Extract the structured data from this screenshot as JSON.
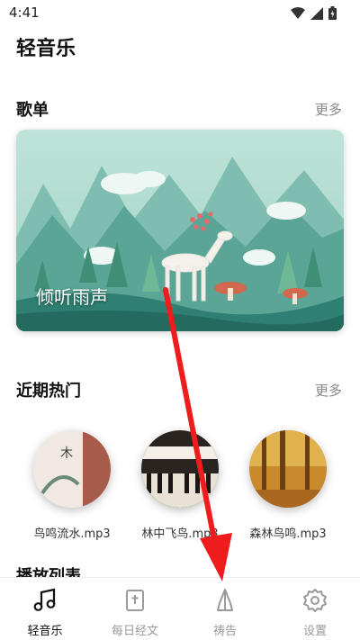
{
  "status": {
    "time": "4:41"
  },
  "app": {
    "title": "轻音乐"
  },
  "playlists": {
    "title": "歌单",
    "more": "更多",
    "featured_label": "倾听雨声"
  },
  "recent": {
    "title": "近期热门",
    "more": "更多",
    "items": [
      {
        "name": "鸟鸣流水.mp3"
      },
      {
        "name": "林中飞鸟.mp3"
      },
      {
        "name": "森林鸟鸣.mp3"
      }
    ]
  },
  "queue": {
    "title": "播放列表"
  },
  "nav": {
    "items": [
      {
        "label": "轻音乐",
        "icon": "music-note-icon",
        "active": true
      },
      {
        "label": "每日经文",
        "icon": "bible-icon"
      },
      {
        "label": "祷告",
        "icon": "praying-hands-icon"
      },
      {
        "label": "设置",
        "icon": "gear-icon"
      }
    ]
  },
  "colors": {
    "accent": "#111111",
    "inactive": "#9a9a9a",
    "arrow": "#ee1c1c"
  }
}
